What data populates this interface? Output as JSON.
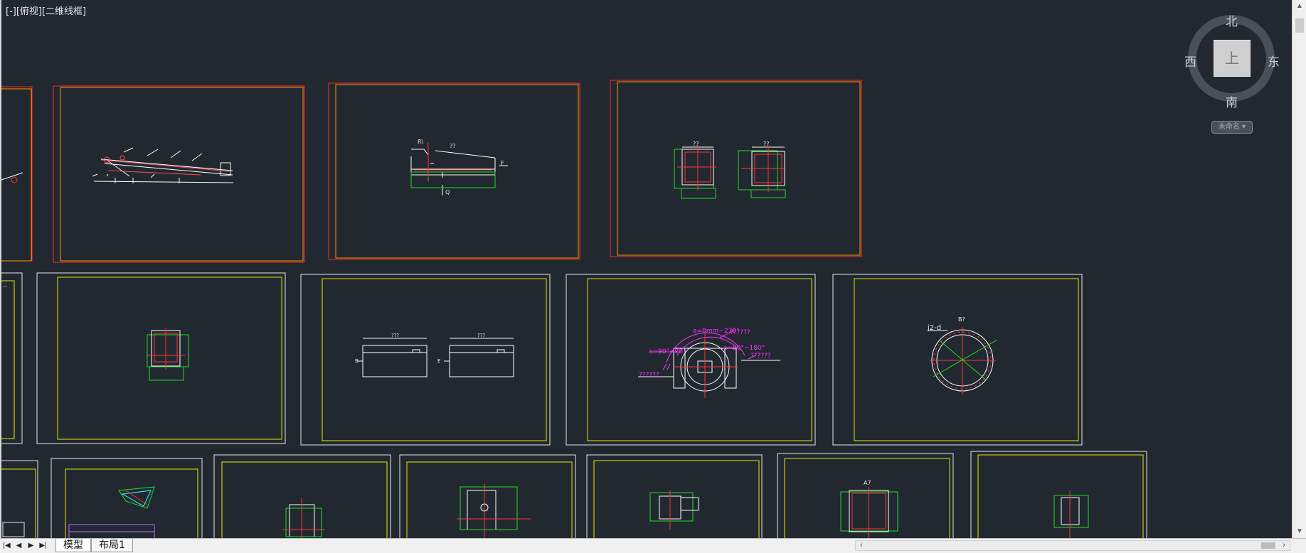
{
  "viewport": {
    "label": "[-][俯视][二维线框]"
  },
  "viewcube": {
    "north": "北",
    "south": "南",
    "east": "东",
    "west": "西",
    "face": "上",
    "ucs_label": "未命名 ▾"
  },
  "drawing_texts": {
    "arrow_label": "F",
    "dim_q": "Q",
    "section_1": "??",
    "section_2": "??",
    "section_3": "??",
    "section_4": "???",
    "section_5": "???",
    "angle_1": "a=8mm~270°",
    "angle_2": "a=90°~180°",
    "angle_3": "a=90°~90°",
    "note_1": "??????",
    "note_2": "??????",
    "note_3": "??????",
    "flange_label": "j2-d",
    "flange_title": "B?",
    "view_a": "A7",
    "label_b": "B",
    "label_e": "E"
  },
  "tabs": {
    "model": "模型",
    "layout1": "布局1"
  },
  "colors": {
    "background": "#212830",
    "frame_red": "#ff2a2a",
    "frame_orange": "#ff9900",
    "frame_yellow": "#e6e600",
    "frame_white": "#e8e8e8",
    "green": "#22dd22",
    "magenta": "#ff33ff"
  }
}
